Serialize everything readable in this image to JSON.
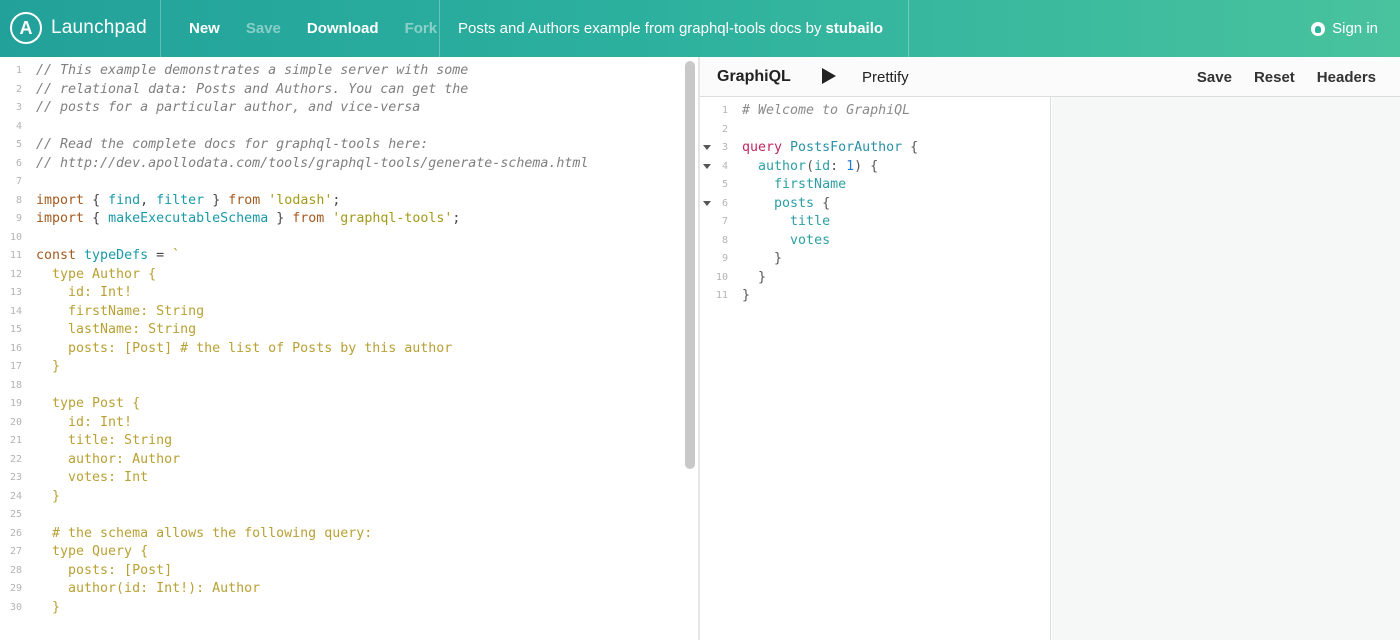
{
  "header": {
    "brand": "Launchpad",
    "logo_letter": "A",
    "nav": [
      "New",
      "Save",
      "Download",
      "Fork"
    ],
    "title_prefix": "Posts and Authors example from graphql-tools docs by",
    "title_author": "stubailo",
    "signin_label": "Sign in",
    "colors": {
      "gradient_start": "#22a19a",
      "gradient_end": "#49c39e"
    }
  },
  "left_editor": {
    "lines": [
      {
        "n": "1",
        "t": "// This example demonstrates a simple server with some"
      },
      {
        "n": "2",
        "t": "// relational data: Posts and Authors. You can get the"
      },
      {
        "n": "3",
        "t": "// posts for a particular author, and vice-versa"
      },
      {
        "n": "4",
        "t": ""
      },
      {
        "n": "5",
        "t": "// Read the complete docs for graphql-tools here:"
      },
      {
        "n": "6",
        "t": "// http://dev.apollodata.com/tools/graphql-tools/generate-schema.html"
      },
      {
        "n": "7",
        "t": ""
      },
      {
        "n": "8",
        "t": "import { find, filter } from 'lodash';"
      },
      {
        "n": "9",
        "t": "import { makeExecutableSchema } from 'graphql-tools';"
      },
      {
        "n": "10",
        "t": ""
      },
      {
        "n": "11",
        "t": "const typeDefs = `"
      },
      {
        "n": "12",
        "t": "  type Author {"
      },
      {
        "n": "13",
        "t": "    id: Int!"
      },
      {
        "n": "14",
        "t": "    firstName: String"
      },
      {
        "n": "15",
        "t": "    lastName: String"
      },
      {
        "n": "16",
        "t": "    posts: [Post] # the list of Posts by this author"
      },
      {
        "n": "17",
        "t": "  }"
      },
      {
        "n": "18",
        "t": ""
      },
      {
        "n": "19",
        "t": "  type Post {"
      },
      {
        "n": "20",
        "t": "    id: Int!"
      },
      {
        "n": "21",
        "t": "    title: String"
      },
      {
        "n": "22",
        "t": "    author: Author"
      },
      {
        "n": "23",
        "t": "    votes: Int"
      },
      {
        "n": "24",
        "t": "  }"
      },
      {
        "n": "25",
        "t": ""
      },
      {
        "n": "26",
        "t": "  # the schema allows the following query:"
      },
      {
        "n": "27",
        "t": "  type Query {"
      },
      {
        "n": "28",
        "t": "    posts: [Post]"
      },
      {
        "n": "29",
        "t": "    author(id: Int!): Author"
      },
      {
        "n": "30",
        "t": "  }"
      }
    ]
  },
  "graphiql": {
    "logo": "GraphiQL",
    "prettify": "Prettify",
    "actions": [
      "Save",
      "Reset",
      "Headers"
    ],
    "lines": [
      {
        "n": "1",
        "t": "# Welcome to GraphiQL"
      },
      {
        "n": "2",
        "t": ""
      },
      {
        "n": "3",
        "t": "query PostsForAuthor {"
      },
      {
        "n": "4",
        "t": "  author(id: 1) {"
      },
      {
        "n": "5",
        "t": "    firstName"
      },
      {
        "n": "6",
        "t": "    posts {"
      },
      {
        "n": "7",
        "t": "      title"
      },
      {
        "n": "8",
        "t": "      votes"
      },
      {
        "n": "9",
        "t": "    }"
      },
      {
        "n": "10",
        "t": "  }"
      },
      {
        "n": "11",
        "t": "}"
      }
    ]
  }
}
